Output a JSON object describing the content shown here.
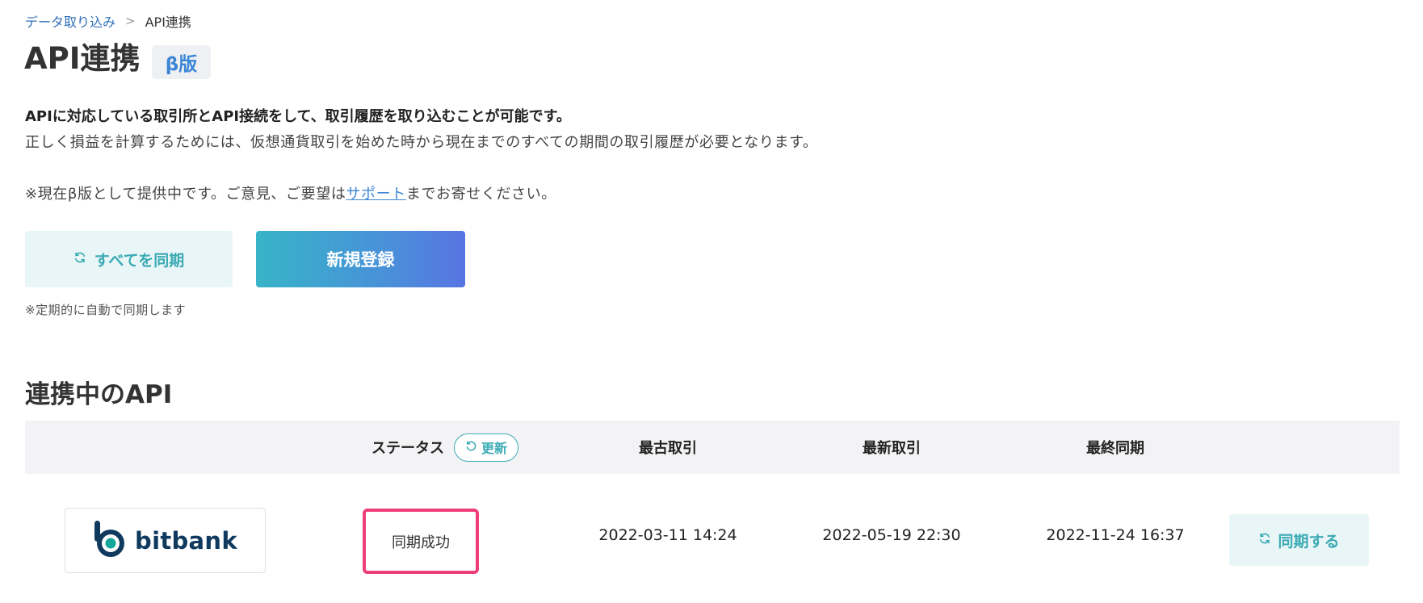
{
  "breadcrumb": {
    "parent": "データ取り込み",
    "separator": ">",
    "current": "API連携"
  },
  "page": {
    "title": "API連携",
    "badge": "β版"
  },
  "description": {
    "bold": "APIに対応している取引所とAPI接続をして、取引履歴を取り込むことが可能です。",
    "normal": "正しく損益を計算するためには、仮想通貨取引を始めた時から現在までのすべての期間の取引履歴が必要となります。",
    "beta_prefix": "※現在β版として提供中です。ご意見、ご要望は",
    "support_link": "サポート",
    "beta_suffix": "までお寄せください。"
  },
  "actions": {
    "sync_all_label": "すべてを同期",
    "new_registration_label": "新規登録",
    "auto_sync_note": "※定期的に自動で同期します"
  },
  "section": {
    "title": "連携中のAPI"
  },
  "table": {
    "headers": {
      "status": "ステータス",
      "refresh": "更新",
      "oldest": "最古取引",
      "latest": "最新取引",
      "last_sync": "最終同期"
    },
    "rows": [
      {
        "exchange": "bitbank",
        "status": "同期成功",
        "oldest": "2022-03-11 14:24",
        "latest": "2022-05-19 22:30",
        "last_sync": "2022-11-24 16:37",
        "action": "同期する"
      }
    ]
  },
  "colors": {
    "accent_teal": "#3aaab4",
    "link_blue": "#3b86d6",
    "status_highlight": "#ee3e7a",
    "brand_navy": "#0f3a5e",
    "gradient_start": "#37b4c8",
    "gradient_end": "#5874e2"
  },
  "icons": {
    "sync": "refresh-icon",
    "logo": "bitbank-logo-icon"
  }
}
